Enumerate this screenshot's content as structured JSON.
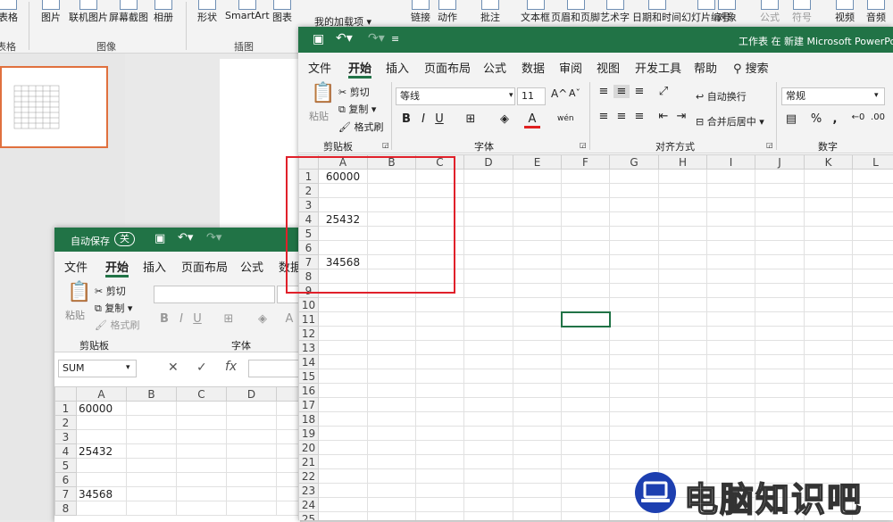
{
  "ppt": {
    "ribbon_items": [
      "表格",
      "图片",
      "联机图片",
      "屏幕截图",
      "相册",
      "形状",
      "SmartArt",
      "图表",
      "我的加载项",
      "链接",
      "动作",
      "批注",
      "文本框",
      "页眉和页脚",
      "艺术字",
      "日期和时间",
      "幻灯片编号",
      "对象",
      "公式",
      "符号",
      "视频",
      "音频"
    ],
    "groups": [
      "表格",
      "图像",
      "插图"
    ]
  },
  "back_excel": {
    "autosave_label": "自动保存",
    "autosave_state": "关",
    "tabs": [
      "文件",
      "开始",
      "插入",
      "页面布局",
      "公式",
      "数据"
    ],
    "clipboard": {
      "cut": "剪切",
      "copy": "复制",
      "painter": "格式刷",
      "paste": "粘贴",
      "group": "剪贴板"
    },
    "font_group": "字体",
    "namebox": "SUM",
    "cols": [
      "A",
      "B",
      "C",
      "D"
    ],
    "rows": [
      [
        "1",
        "60000"
      ],
      [
        "2",
        ""
      ],
      [
        "3",
        ""
      ],
      [
        "4",
        "25432"
      ],
      [
        "5",
        ""
      ],
      [
        "6",
        ""
      ],
      [
        "7",
        "34568"
      ],
      [
        "8",
        ""
      ]
    ]
  },
  "front_excel": {
    "title": "工作表 在 新建 Microsoft PowerPoint",
    "tabs": [
      "文件",
      "开始",
      "插入",
      "页面布局",
      "公式",
      "数据",
      "审阅",
      "视图",
      "开发工具",
      "帮助"
    ],
    "search": "搜索",
    "clipboard": {
      "cut": "剪切",
      "copy": "复制",
      "painter": "格式刷",
      "paste": "粘贴",
      "group": "剪贴板"
    },
    "font": {
      "name": "等线",
      "size": "11",
      "group": "字体"
    },
    "alignment": {
      "wrap": "自动换行",
      "merge": "合并后居中",
      "group": "对齐方式"
    },
    "number": {
      "format": "常规",
      "group": "数字"
    },
    "cols": [
      "A",
      "B",
      "C",
      "D",
      "E",
      "F",
      "G",
      "H",
      "I",
      "J",
      "K",
      "L"
    ],
    "values": {
      "1": "60000",
      "4": "25432",
      "7": "34568"
    },
    "row_count": 25
  },
  "watermark": "电脑知识吧"
}
